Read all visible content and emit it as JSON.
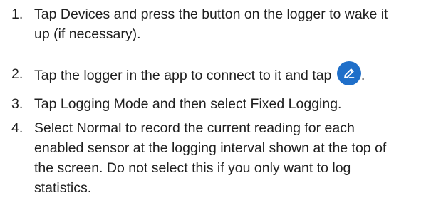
{
  "steps": [
    {
      "number": "1.",
      "lines": [
        "Tap Devices and press the button on the logger to wake it",
        "up (if necessary)."
      ]
    },
    {
      "number": "2.",
      "before_icon": "Tap the logger in the app to connect to it and tap",
      "icon": "edit-icon",
      "after_icon": "."
    },
    {
      "number": "3.",
      "lines": [
        "Tap Logging Mode and then select Fixed Logging."
      ]
    },
    {
      "number": "4.",
      "lines": [
        "Select Normal to record the current reading for each",
        "enabled sensor at the logging interval shown at the top of",
        "the screen. Do not select this if you only want to log",
        "statistics."
      ]
    }
  ],
  "colors": {
    "text": "#1f1f1f",
    "icon_background": "#1f6fc9",
    "icon_foreground": "#ffffff"
  }
}
